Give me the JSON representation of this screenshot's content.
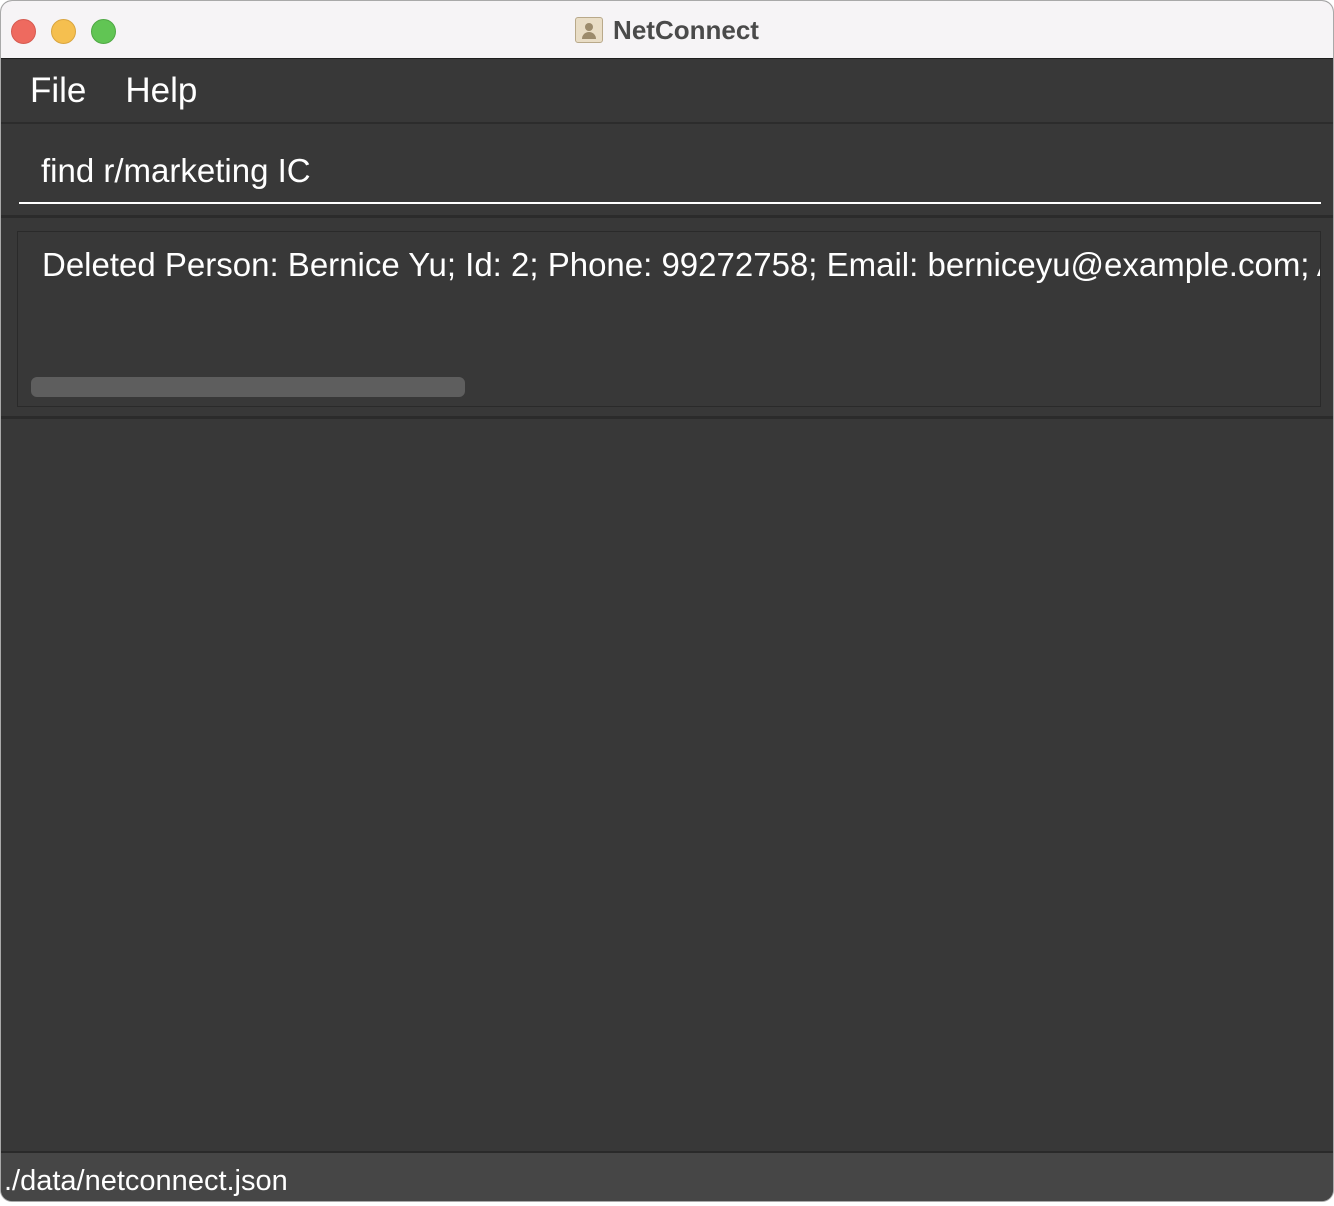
{
  "window": {
    "title": "NetConnect"
  },
  "menu": {
    "items": [
      {
        "label": "File"
      },
      {
        "label": "Help"
      }
    ]
  },
  "command": {
    "value": "find r/marketing IC"
  },
  "result": {
    "text": "Deleted Person: Bernice Yu; Id: 2; Phone: 99272758; Email: berniceyu@example.com; Ac"
  },
  "status": {
    "path": "./data/netconnect.json"
  },
  "colors": {
    "background": "#383838",
    "titlebar": "#f6f4f6",
    "close": "#ee6a5f",
    "minimize": "#f5bf4f",
    "maximize": "#61c554"
  }
}
